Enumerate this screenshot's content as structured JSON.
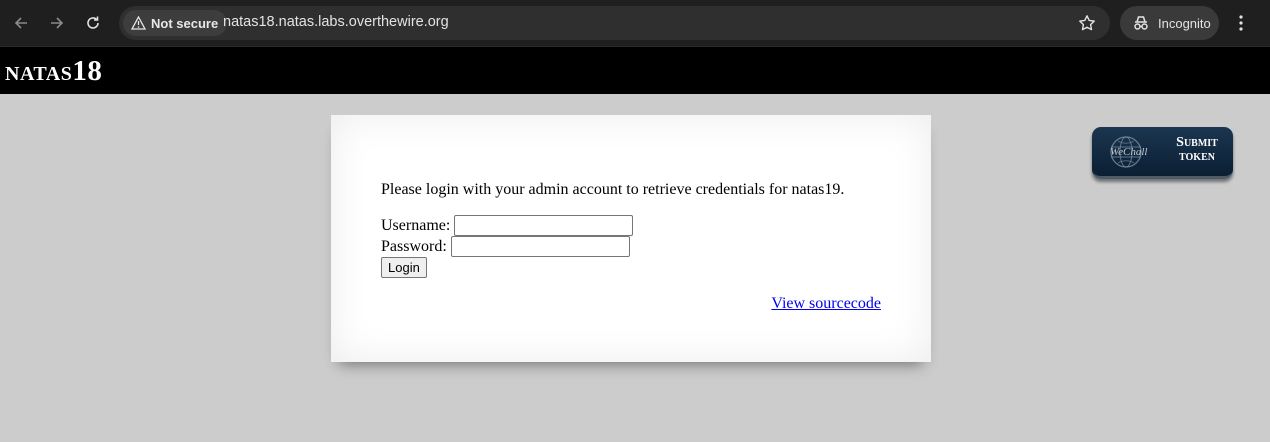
{
  "browser": {
    "security_label": "Not secure",
    "url": "natas18.natas.labs.overthewire.org",
    "incognito_label": "Incognito"
  },
  "header": {
    "logo": "natas18"
  },
  "content": {
    "intro": "Please login with your admin account to retrieve credentials for natas19.",
    "username_label": "Username:",
    "username_value": "",
    "password_label": "Password:",
    "password_value": "",
    "login_button": "Login",
    "view_source_link": "View sourcecode"
  },
  "token_badge": {
    "brand": "WeChall",
    "label": "Submit token"
  },
  "icons": [
    "back-icon",
    "forward-icon",
    "reload-icon",
    "warning-icon",
    "star-icon",
    "incognito-icon",
    "more-vert-icon",
    "globe-icon"
  ]
}
